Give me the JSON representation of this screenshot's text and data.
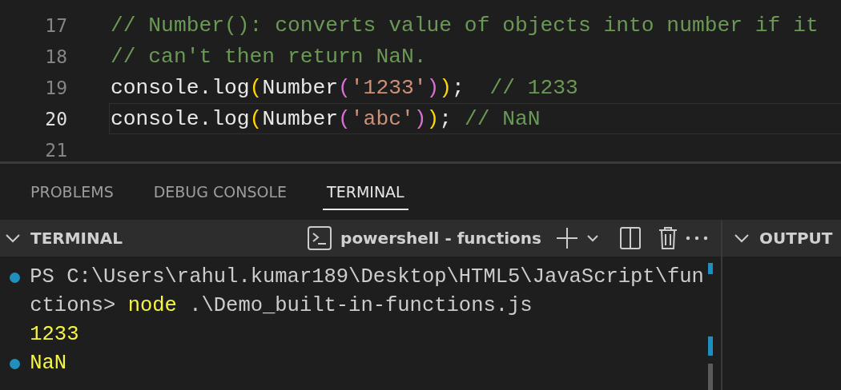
{
  "editor": {
    "lines": [
      {
        "number": "17",
        "current": false,
        "tokens": [
          {
            "kind": "comment",
            "text": "// Number(): converts value of objects into number if it"
          }
        ]
      },
      {
        "number": "18",
        "current": false,
        "tokens": [
          {
            "kind": "comment",
            "text": "// can't then return NaN."
          }
        ]
      },
      {
        "number": "19",
        "current": false,
        "tokens": [
          {
            "kind": "plain",
            "text": "console.log"
          },
          {
            "kind": "bracket1",
            "text": "("
          },
          {
            "kind": "plain",
            "text": "Number"
          },
          {
            "kind": "bracket2",
            "text": "("
          },
          {
            "kind": "string",
            "text": "'1233'"
          },
          {
            "kind": "bracket2",
            "text": ")"
          },
          {
            "kind": "bracket1",
            "text": ")"
          },
          {
            "kind": "plain",
            "text": ";  "
          },
          {
            "kind": "comment",
            "text": "// 1233"
          }
        ]
      },
      {
        "number": "20",
        "current": true,
        "tokens": [
          {
            "kind": "plain",
            "text": "console.log"
          },
          {
            "kind": "bracket1",
            "text": "("
          },
          {
            "kind": "plain",
            "text": "Number"
          },
          {
            "kind": "bracket2",
            "text": "("
          },
          {
            "kind": "string",
            "text": "'abc'"
          },
          {
            "kind": "bracket2",
            "text": ")"
          },
          {
            "kind": "bracket1",
            "text": ")"
          },
          {
            "kind": "plain",
            "text": "; "
          },
          {
            "kind": "comment",
            "text": "// NaN"
          }
        ]
      },
      {
        "number": "21",
        "current": false
      }
    ]
  },
  "panel_tabs": [
    {
      "label": "PROBLEMS",
      "selected": false
    },
    {
      "label": "DEBUG CONSOLE",
      "selected": false
    },
    {
      "label": "TERMINAL",
      "selected": true
    }
  ],
  "terminal": {
    "title": "TERMINAL",
    "shell": "powershell - functions",
    "lines": [
      {
        "marked": true,
        "segments": [
          {
            "kind": "prompt",
            "text": "PS C:\\Users\\rahul.kumar189\\Desktop\\HTML5\\JavaScript\\functions> "
          },
          {
            "kind": "command",
            "text": "node"
          },
          {
            "kind": "prompt",
            "text": " .\\Demo_built-in-functions.js"
          }
        ]
      },
      {
        "marked": false,
        "segments": [
          {
            "kind": "output",
            "text": "1233"
          }
        ]
      },
      {
        "marked": true,
        "segments": [
          {
            "kind": "output",
            "text": "NaN"
          }
        ]
      }
    ]
  },
  "output": {
    "title": "OUTPUT"
  }
}
